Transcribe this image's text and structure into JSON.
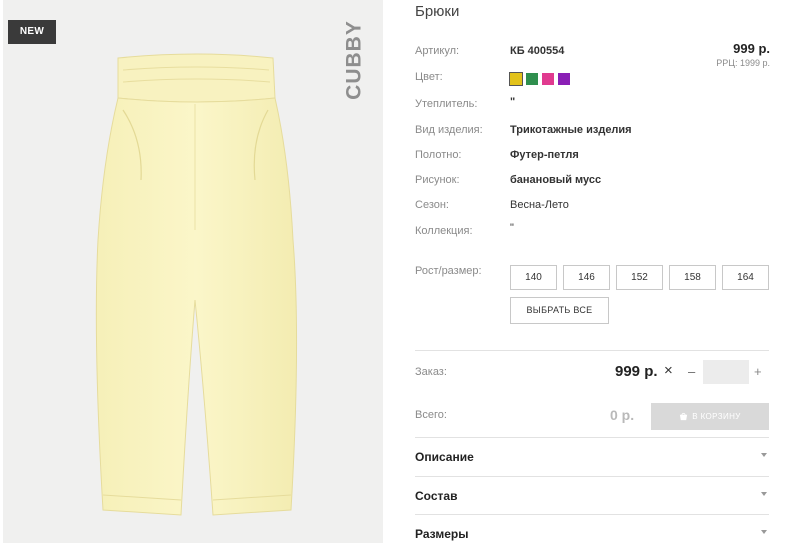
{
  "badge": "NEW",
  "brand": "CUBBY",
  "product": {
    "title": "Брюки",
    "price": "999 р.",
    "rrp": "РРЦ: 1999 р."
  },
  "attributes": [
    {
      "label": "Артикул:",
      "value": "КБ 400554"
    },
    {
      "label": "Цвет:",
      "value": ""
    },
    {
      "label": "Утеплитель:",
      "value": "\""
    },
    {
      "label": "Вид изделия:",
      "value": "Трикотажные изделия"
    },
    {
      "label": "Полотно:",
      "value": "Футер-петля"
    },
    {
      "label": "Рисунок:",
      "value": "банановый мусс"
    },
    {
      "label": "Сезон:",
      "value": "Весна-Лето"
    },
    {
      "label": "Коллекция:",
      "value": "\""
    }
  ],
  "colors": [
    "#e2c21a",
    "#2f8f4e",
    "#e03a8f",
    "#8a1fb5"
  ],
  "size_label": "Рост/размер:",
  "sizes": [
    "140",
    "146",
    "152",
    "158",
    "164"
  ],
  "select_all": "ВЫБРАТЬ ВСЕ",
  "order": {
    "label": "Заказ:",
    "price": "999 р.",
    "times": "×",
    "minus": "–",
    "plus": "+",
    "quantity": ""
  },
  "total": {
    "label": "Всего:",
    "value": "0 р.",
    "cart_button": "В КОРЗИНУ"
  },
  "accordion": [
    "Описание",
    "Состав",
    "Размеры"
  ]
}
